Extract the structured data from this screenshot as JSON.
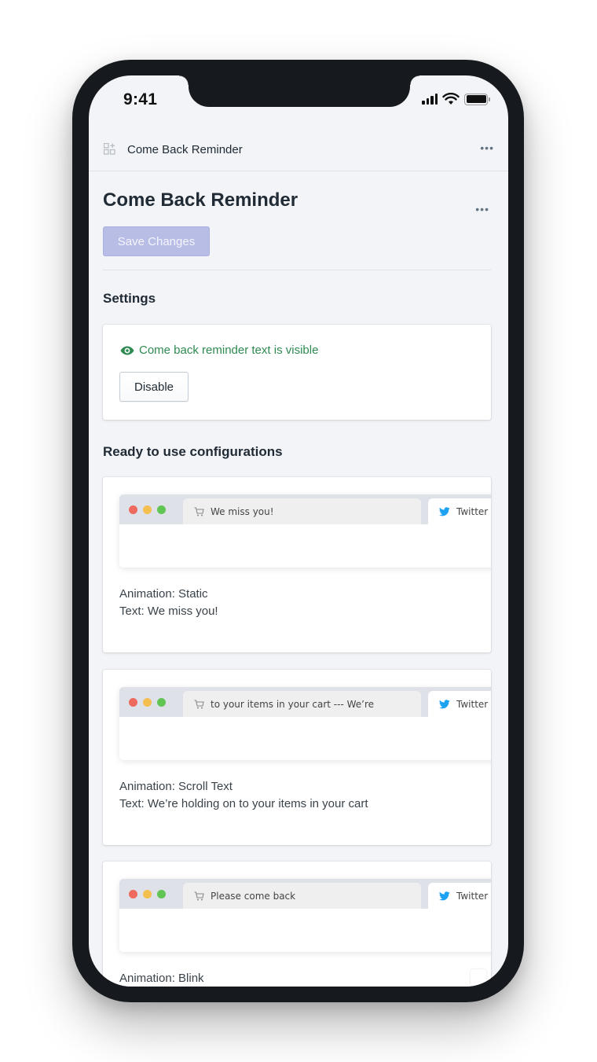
{
  "status_bar": {
    "time": "9:41",
    "icons": [
      "cellular-signal-icon",
      "wifi-icon",
      "battery-icon"
    ]
  },
  "app_header": {
    "icon": "apps-grid-icon",
    "title": "Come Back Reminder",
    "more_icon": "more-horizontal-icon",
    "more_label": "•••"
  },
  "page": {
    "title": "Come Back Reminder",
    "more_label": "•••",
    "save_label": "Save Changes"
  },
  "settings": {
    "heading": "Settings",
    "status_icon": "eye-icon",
    "status_text": "Come back reminder text is visible",
    "disable_label": "Disable"
  },
  "configurations": {
    "heading": "Ready to use configurations",
    "items": [
      {
        "tab_title": "We miss you!",
        "other_tab": "Twitter",
        "animation_line": "Animation: Static",
        "text_line": "Text: We miss you!"
      },
      {
        "tab_title": "to your items in your cart --- We’re",
        "other_tab": "Twitter",
        "animation_line": "Animation: Scroll Text",
        "text_line": "Text: We’re holding on to your items in your cart"
      },
      {
        "tab_title": "Please come back",
        "other_tab": "Twitter",
        "animation_line": "Animation: Blink",
        "text_line": ""
      }
    ]
  },
  "colors": {
    "primary_disabled": "#b8bde6",
    "success_green": "#2f8a52",
    "page_bg": "#f2f4f7",
    "frame": "#16191e",
    "twitter_blue": "#1da1f2"
  }
}
